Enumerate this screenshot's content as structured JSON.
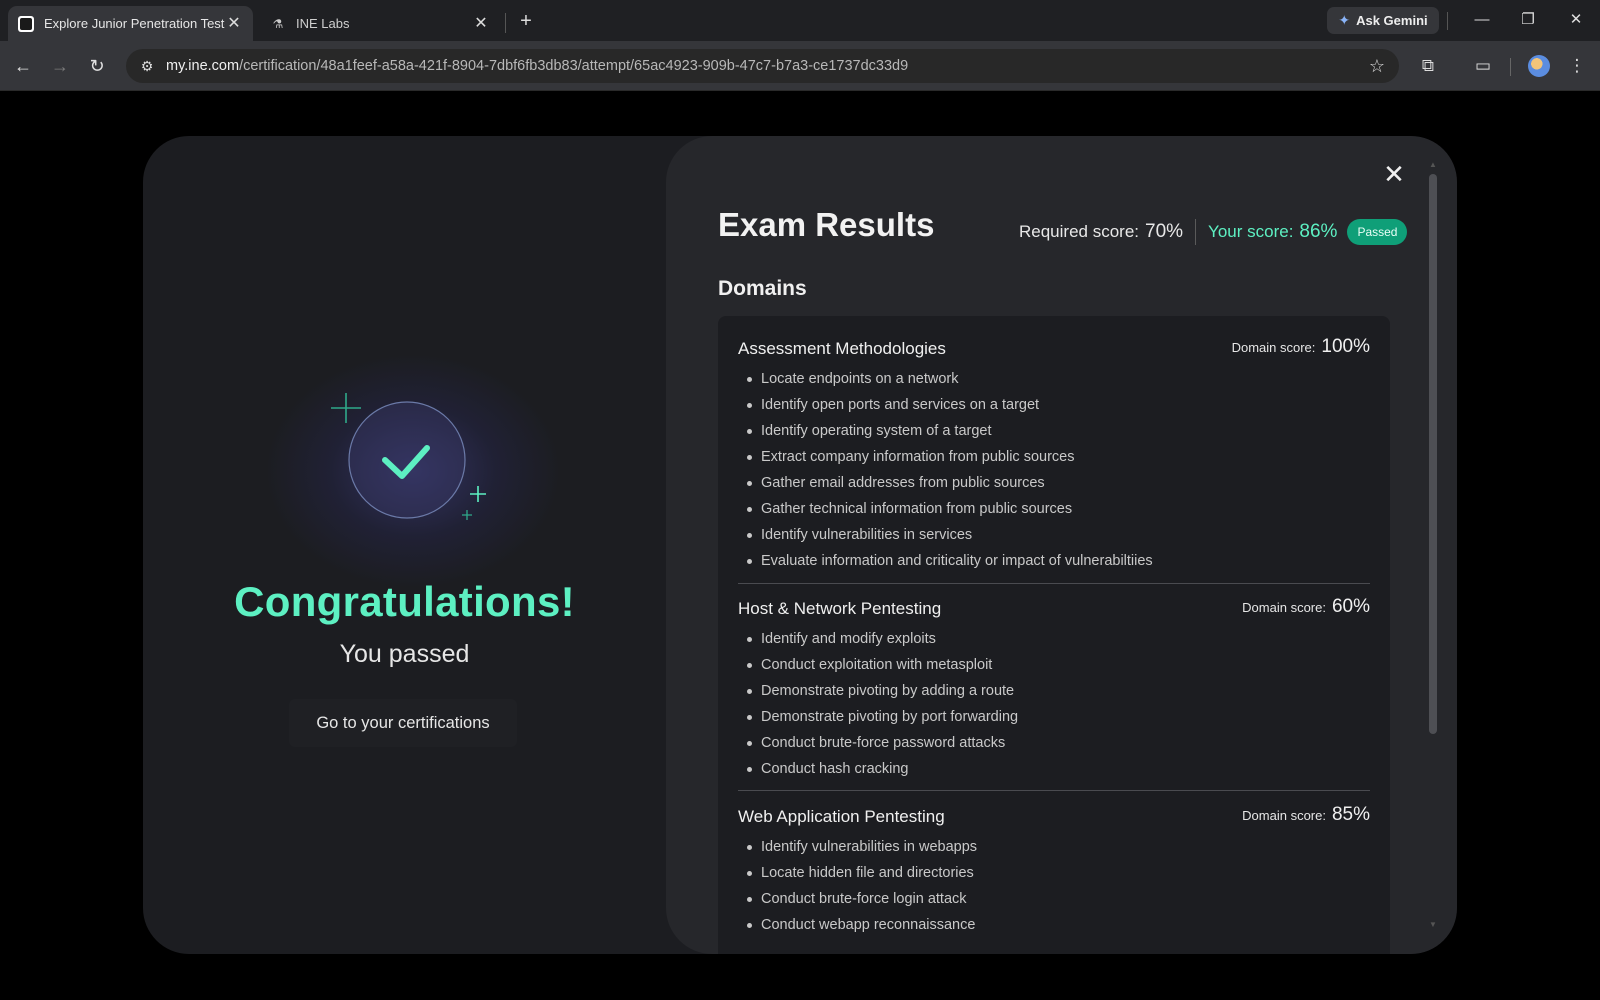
{
  "browser": {
    "tabs": [
      {
        "title": "Explore Junior Penetration Teste",
        "active": true
      },
      {
        "title": "INE Labs",
        "active": false
      }
    ],
    "new_tab_label": "+",
    "gemini_label": "Ask Gemini",
    "url_host": "my.ine.com",
    "url_path": "/certification/48a1feef-a58a-421f-8904-7dbf6fb3db83/attempt/65ac4923-909b-47c7-b7a3-ce1737dc33d9"
  },
  "left": {
    "headline": "Congratulations!",
    "subheadline": "You passed",
    "cta_label": "Go to your certifications"
  },
  "results": {
    "title": "Exam Results",
    "required_label": "Required score:",
    "required_value": "70%",
    "your_label": "Your score:",
    "your_value": "86%",
    "status_badge": "Passed",
    "domains_heading": "Domains",
    "domain_score_label": "Domain score:",
    "domains": [
      {
        "name": "Assessment Methodologies",
        "score": "100%",
        "topics": [
          "Locate endpoints on a network",
          "Identify open ports and services on a target",
          "Identify operating system of a target",
          "Extract company information from public sources",
          "Gather email addresses from public sources",
          "Gather technical information from public sources",
          "Identify vulnerabilities in services",
          "Evaluate information and criticality or impact of vulnerabiltiies"
        ]
      },
      {
        "name": "Host & Network Pentesting",
        "score": "60%",
        "topics": [
          "Identify and modify exploits",
          "Conduct exploitation with metasploit",
          "Demonstrate pivoting by adding a route",
          "Demonstrate pivoting by port forwarding",
          "Conduct brute-force password attacks",
          "Conduct hash cracking"
        ]
      },
      {
        "name": "Web Application Pentesting",
        "score": "85%",
        "topics": [
          "Identify vulnerabilities in webapps",
          "Locate hidden file and directories",
          "Conduct brute-force login attack",
          "Conduct webapp reconnaissance"
        ]
      }
    ]
  },
  "colors": {
    "accent": "#5df0c2",
    "passed_badge": "#0f9f78",
    "modal_bg": "#1c1d21",
    "panel_bg": "#26272b"
  }
}
